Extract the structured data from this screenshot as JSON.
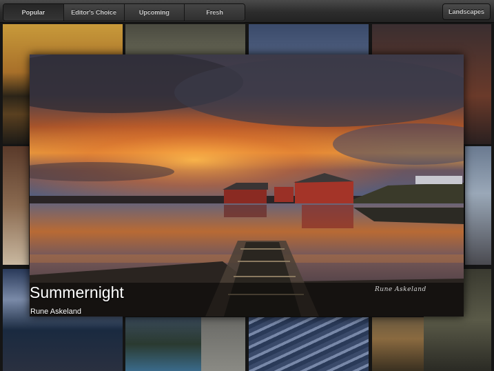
{
  "toolbar": {
    "tabs": [
      {
        "label": "Popular",
        "active": true
      },
      {
        "label": "Editor's Choice",
        "active": false
      },
      {
        "label": "Upcoming",
        "active": false
      },
      {
        "label": "Fresh",
        "active": false
      }
    ],
    "category_button": "Landscapes"
  },
  "featured": {
    "title": "Summernight",
    "author": "Rune Askeland",
    "signature": "Rune Askeland"
  }
}
